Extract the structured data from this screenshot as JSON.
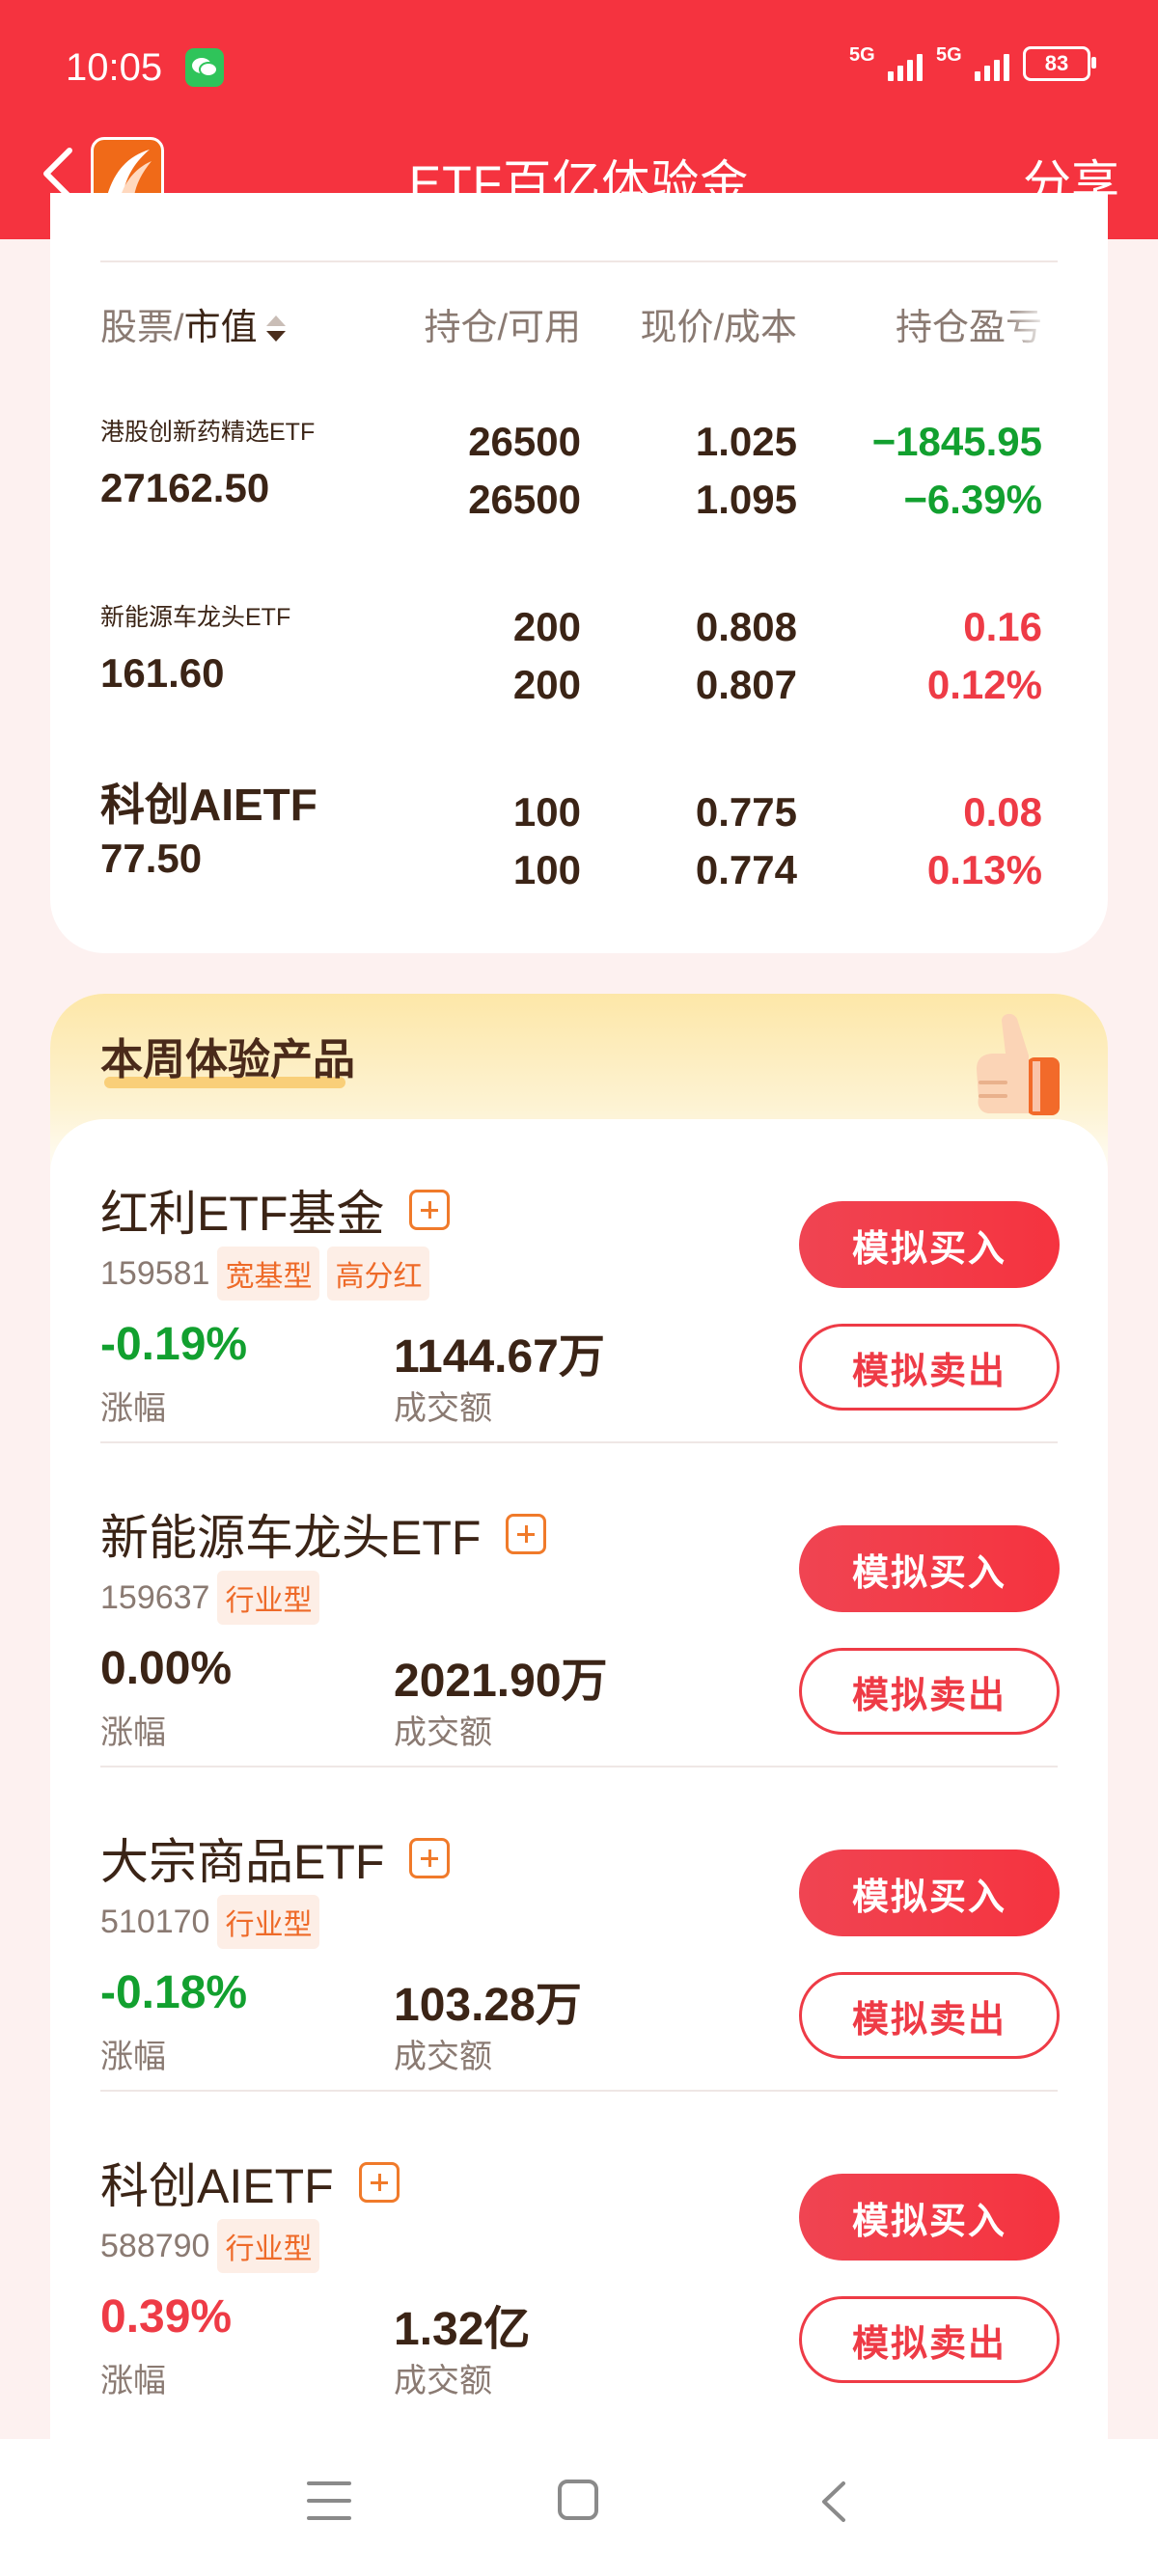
{
  "status_bar": {
    "time": "10:05",
    "signal1": "5G",
    "signal2": "5G",
    "battery": "83"
  },
  "header": {
    "title": "ETF百亿体验金",
    "share": "分享"
  },
  "holdings": {
    "columns": {
      "stock": "股票/",
      "market_value": "市值",
      "position": "持仓/可用",
      "price": "现价/成本",
      "pl": "持仓盈亏"
    },
    "rows": [
      {
        "name": "港股创新药精选ETF",
        "value": "27162.50",
        "hold": "26500",
        "avail": "26500",
        "price": "1.025",
        "cost": "1.095",
        "pl": "−1845.95",
        "pl_pct": "−6.39%",
        "trend": "down"
      },
      {
        "name": "新能源车龙头ETF",
        "value": "161.60",
        "hold": "200",
        "avail": "200",
        "price": "0.808",
        "cost": "0.807",
        "pl": "0.16",
        "pl_pct": "0.12%",
        "trend": "up"
      },
      {
        "name": "科创AIETF",
        "value": "77.50",
        "hold": "100",
        "avail": "100",
        "price": "0.775",
        "cost": "0.774",
        "pl": "0.08",
        "pl_pct": "0.13%",
        "trend": "up"
      }
    ]
  },
  "weekly": {
    "title": "本周体验产品",
    "change_label": "涨幅",
    "volume_label": "成交额",
    "buy_label": "模拟买入",
    "sell_label": "模拟卖出",
    "products": [
      {
        "name": "红利ETF基金",
        "code": "159581",
        "tags": [
          "宽基型",
          "高分红"
        ],
        "change": "-0.19%",
        "trend": "down",
        "volume": "1144.67万"
      },
      {
        "name": "新能源车龙头ETF",
        "code": "159637",
        "tags": [
          "行业型"
        ],
        "change": "0.00%",
        "trend": "flat",
        "volume": "2021.90万"
      },
      {
        "name": "大宗商品ETF",
        "code": "510170",
        "tags": [
          "行业型"
        ],
        "change": "-0.18%",
        "trend": "down",
        "volume": "103.28万"
      },
      {
        "name": "科创AIETF",
        "code": "588790",
        "tags": [
          "行业型"
        ],
        "change": "0.39%",
        "trend": "up",
        "volume": "1.32亿"
      }
    ]
  },
  "colors": {
    "brand_red": "#f5333f",
    "up_red": "#ee3b46",
    "down_green": "#12a02f",
    "tag_orange": "#ee6a28"
  }
}
